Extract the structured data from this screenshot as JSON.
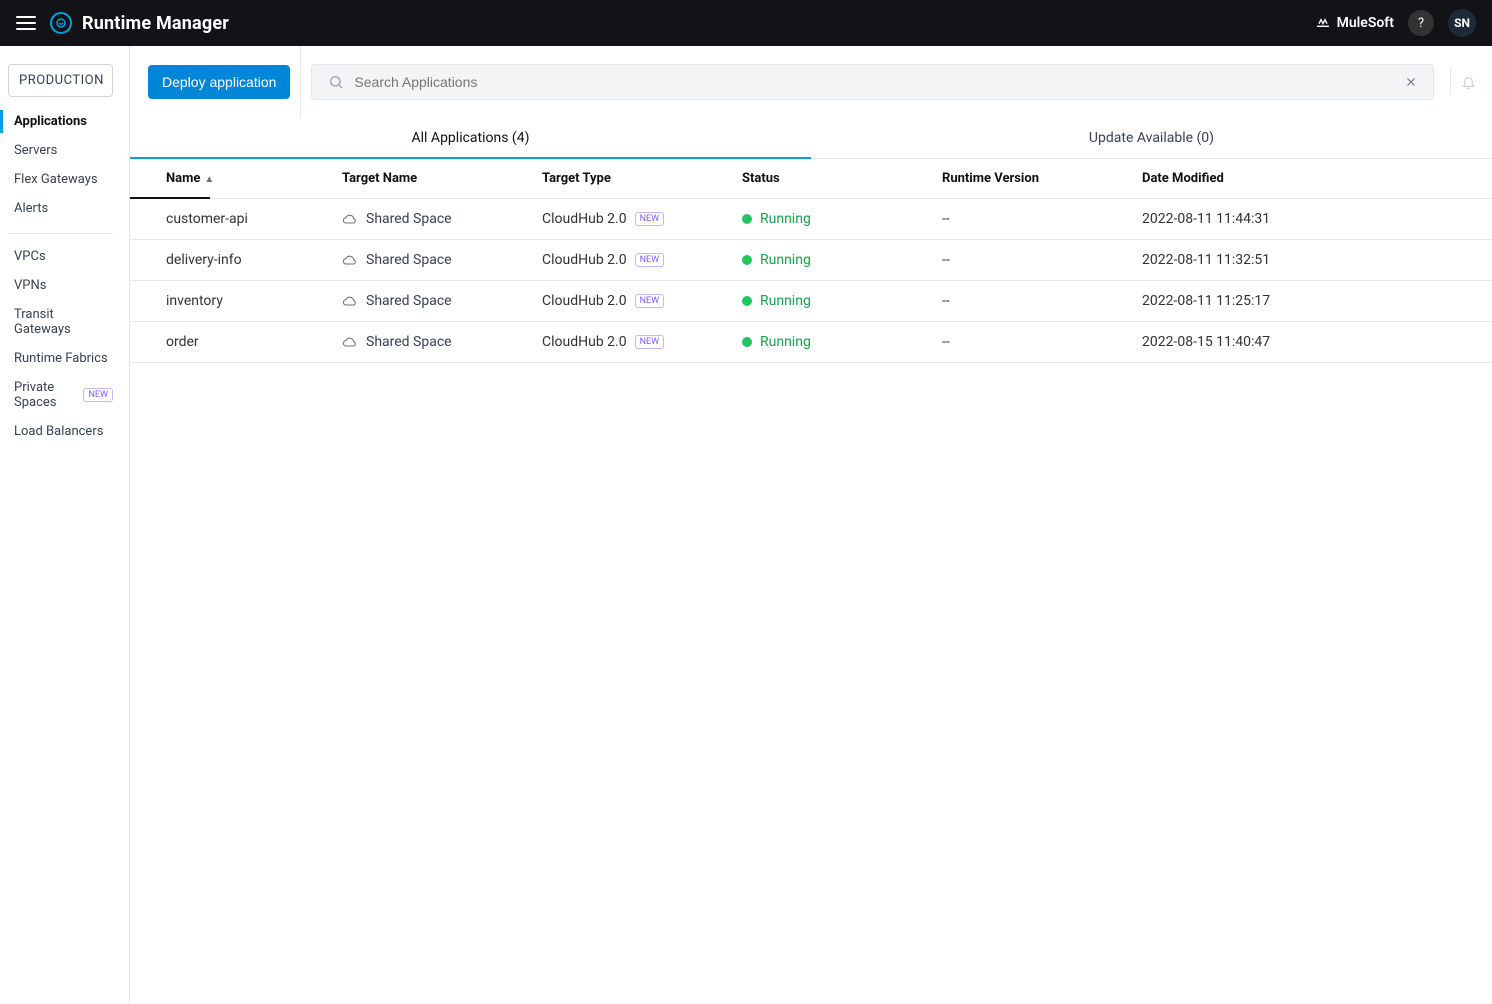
{
  "header": {
    "product_title": "Runtime Manager",
    "brand_name": "MuleSoft",
    "help_label": "?",
    "avatar_initials": "SN"
  },
  "sidebar": {
    "env_label": "PRODUCTION",
    "nav_primary": [
      {
        "label": "Applications",
        "active": true
      },
      {
        "label": "Servers"
      },
      {
        "label": "Flex Gateways"
      },
      {
        "label": "Alerts"
      }
    ],
    "nav_secondary": [
      {
        "label": "VPCs"
      },
      {
        "label": "VPNs"
      },
      {
        "label": "Transit Gateways"
      },
      {
        "label": "Runtime Fabrics"
      },
      {
        "label": "Private Spaces",
        "badge": "NEW"
      },
      {
        "label": "Load Balancers"
      }
    ]
  },
  "toolbar": {
    "deploy_label": "Deploy application",
    "search_placeholder": "Search Applications"
  },
  "tabs": {
    "all_label": "All Applications (4)",
    "update_label": "Update Available (0)"
  },
  "table": {
    "columns": {
      "name": "Name",
      "target_name": "Target Name",
      "target_type": "Target Type",
      "status": "Status",
      "version": "Runtime Version",
      "date": "Date Modified"
    },
    "new_tag": "NEW",
    "rows": [
      {
        "name": "customer-api",
        "target_name": "Shared Space",
        "target_type": "CloudHub 2.0",
        "status": "Running",
        "version": "--",
        "date": "2022-08-11 11:44:31"
      },
      {
        "name": "delivery-info",
        "target_name": "Shared Space",
        "target_type": "CloudHub 2.0",
        "status": "Running",
        "version": "--",
        "date": "2022-08-11 11:32:51"
      },
      {
        "name": "inventory",
        "target_name": "Shared Space",
        "target_type": "CloudHub 2.0",
        "status": "Running",
        "version": "--",
        "date": "2022-08-11 11:25:17"
      },
      {
        "name": "order",
        "target_name": "Shared Space",
        "target_type": "CloudHub 2.0",
        "status": "Running",
        "version": "--",
        "date": "2022-08-15 11:40:47"
      }
    ]
  }
}
